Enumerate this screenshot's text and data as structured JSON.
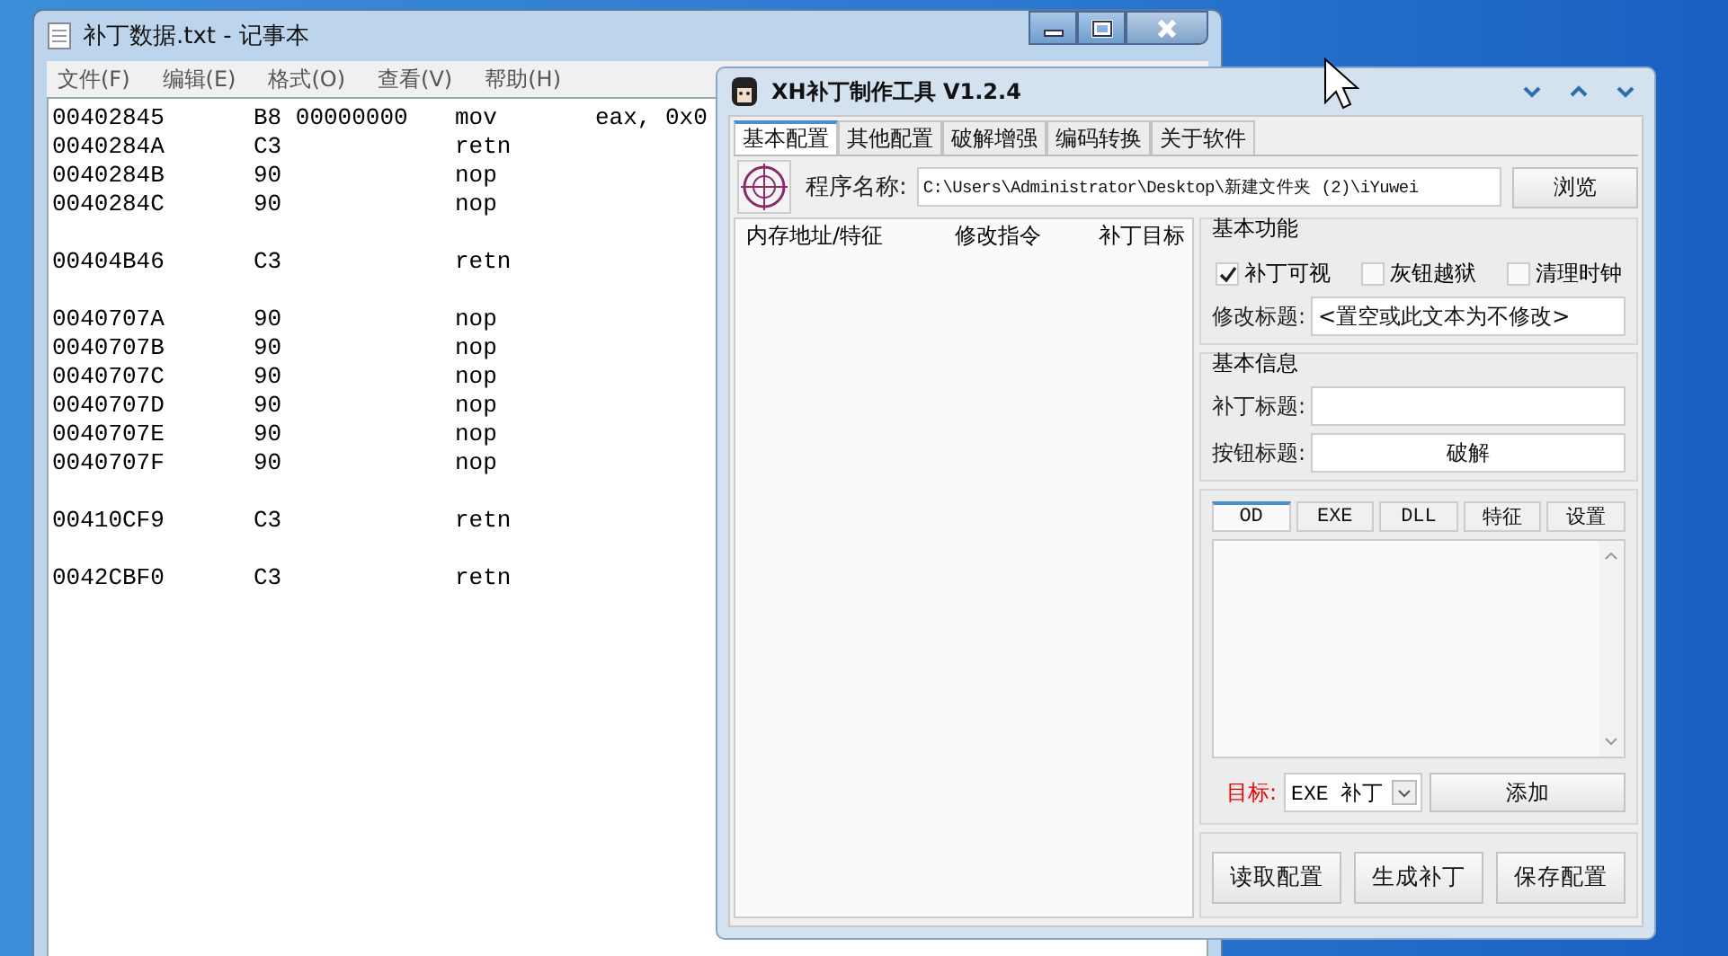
{
  "notepad": {
    "title": "补丁数据.txt - 记事本",
    "menu": [
      "文件(F)",
      "编辑(E)",
      "格式(O)",
      "查看(V)",
      "帮助(H)"
    ],
    "lines": [
      {
        "kind": "code",
        "address": "00402845",
        "bytes": "B8 00000000",
        "mnemonic": "mov",
        "operand": "eax, 0x0"
      },
      {
        "kind": "code",
        "address": "0040284A",
        "bytes": "C3",
        "mnemonic": "retn"
      },
      {
        "kind": "code",
        "address": "0040284B",
        "bytes": "90",
        "mnemonic": "nop"
      },
      {
        "kind": "code",
        "address": "0040284C",
        "bytes": "90",
        "mnemonic": "nop"
      },
      {
        "kind": "blank"
      },
      {
        "kind": "code",
        "address": "00404B46",
        "bytes": "C3",
        "mnemonic": "retn"
      },
      {
        "kind": "blank"
      },
      {
        "kind": "code",
        "address": "0040707A",
        "bytes": "90",
        "mnemonic": "nop"
      },
      {
        "kind": "code",
        "address": "0040707B",
        "bytes": "90",
        "mnemonic": "nop"
      },
      {
        "kind": "code",
        "address": "0040707C",
        "bytes": "90",
        "mnemonic": "nop"
      },
      {
        "kind": "code",
        "address": "0040707D",
        "bytes": "90",
        "mnemonic": "nop"
      },
      {
        "kind": "code",
        "address": "0040707E",
        "bytes": "90",
        "mnemonic": "nop"
      },
      {
        "kind": "code",
        "address": "0040707F",
        "bytes": "90",
        "mnemonic": "nop"
      },
      {
        "kind": "blank"
      },
      {
        "kind": "code",
        "address": "00410CF9",
        "bytes": "C3",
        "mnemonic": "retn"
      },
      {
        "kind": "blank"
      },
      {
        "kind": "code",
        "address": "0042CBF0",
        "bytes": "C3",
        "mnemonic": "retn"
      }
    ]
  },
  "tool": {
    "title": "XH补丁制作工具 V1.2.4",
    "tabs": [
      {
        "label": "基本配置",
        "selected": true
      },
      {
        "label": "其他配置",
        "selected": false
      },
      {
        "label": "破解增强",
        "selected": false
      },
      {
        "label": "编码转换",
        "selected": false
      },
      {
        "label": "关于软件",
        "selected": false
      }
    ],
    "program_label": "程序名称:",
    "program_path": "C:\\Users\\Administrator\\Desktop\\新建文件夹 (2)\\iYuwei",
    "browse_button": "浏览",
    "list_columns": [
      "内存地址/特征",
      "修改指令",
      "补丁目标"
    ],
    "basic_functions": {
      "title": "基本功能",
      "checkboxes": [
        {
          "label": "补丁可视",
          "checked": true
        },
        {
          "label": "灰钮越狱",
          "checked": false
        },
        {
          "label": "清理时钟",
          "checked": false
        }
      ],
      "title_label": "修改标题:",
      "title_value": "<置空或此文本为不修改>"
    },
    "basic_info": {
      "title": "基本信息",
      "patch_title_label": "补丁标题:",
      "button_title_label": "按钮标题:",
      "button_title_value": "破解"
    },
    "sub_tabs": [
      {
        "label": "OD",
        "selected": true
      },
      {
        "label": "EXE",
        "selected": false
      },
      {
        "label": "DLL",
        "selected": false
      },
      {
        "label": "特征",
        "selected": false
      },
      {
        "label": "设置",
        "selected": false
      }
    ],
    "target_label": "目标:",
    "target_value": "EXE 补丁",
    "add_button": "添加",
    "bottom_buttons": [
      "读取配置",
      "生成补丁",
      "保存配置"
    ]
  }
}
